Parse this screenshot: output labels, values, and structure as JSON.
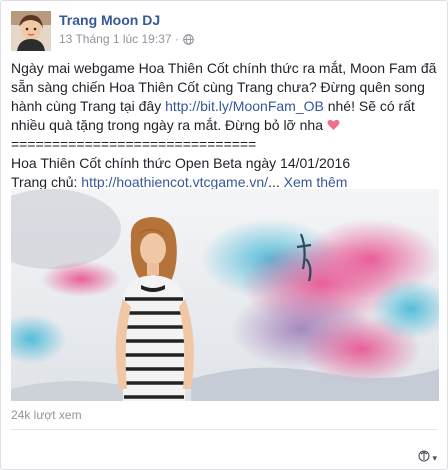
{
  "post": {
    "author": "Trang Moon DJ",
    "timestamp": "13 Tháng 1 lúc 19:37 ·",
    "privacy_icon": "globe-icon",
    "body": {
      "paragraph1_part1": "Ngày mai webgame Hoa Thiên Cốt chính thức ra mắt, Moon Fam đã sẵn sàng chiến Hoa Thiên Cốt cùng Trang chưa? Đừng quên song hành cùng Trang tại đây ",
      "link1": "http://bit.ly/MoonFam_OB",
      "paragraph1_part2": " nhé! Sẽ có rất nhiều quà tặng trong ngày ra mắt. Đừng bỏ lỡ nha ",
      "heart_icon": "heart-icon",
      "separator": "==============================",
      "line2": "Hoa Thiên Cốt chính thức Open Beta ngày 14/01/2016",
      "line3_prefix": "Trang chủ: ",
      "link2": "http://hoathiencot.vtcgame.vn/",
      "ellipsis": "...",
      "see_more": "Xem thêm"
    },
    "video": {
      "description_icon": "video-thumbnail"
    },
    "views": "24k lượt xem",
    "share_icon": "share-audience-icon"
  },
  "colors": {
    "link": "#365899",
    "meta": "#90949c",
    "text": "#1d2129",
    "heart": "#f0708c"
  }
}
